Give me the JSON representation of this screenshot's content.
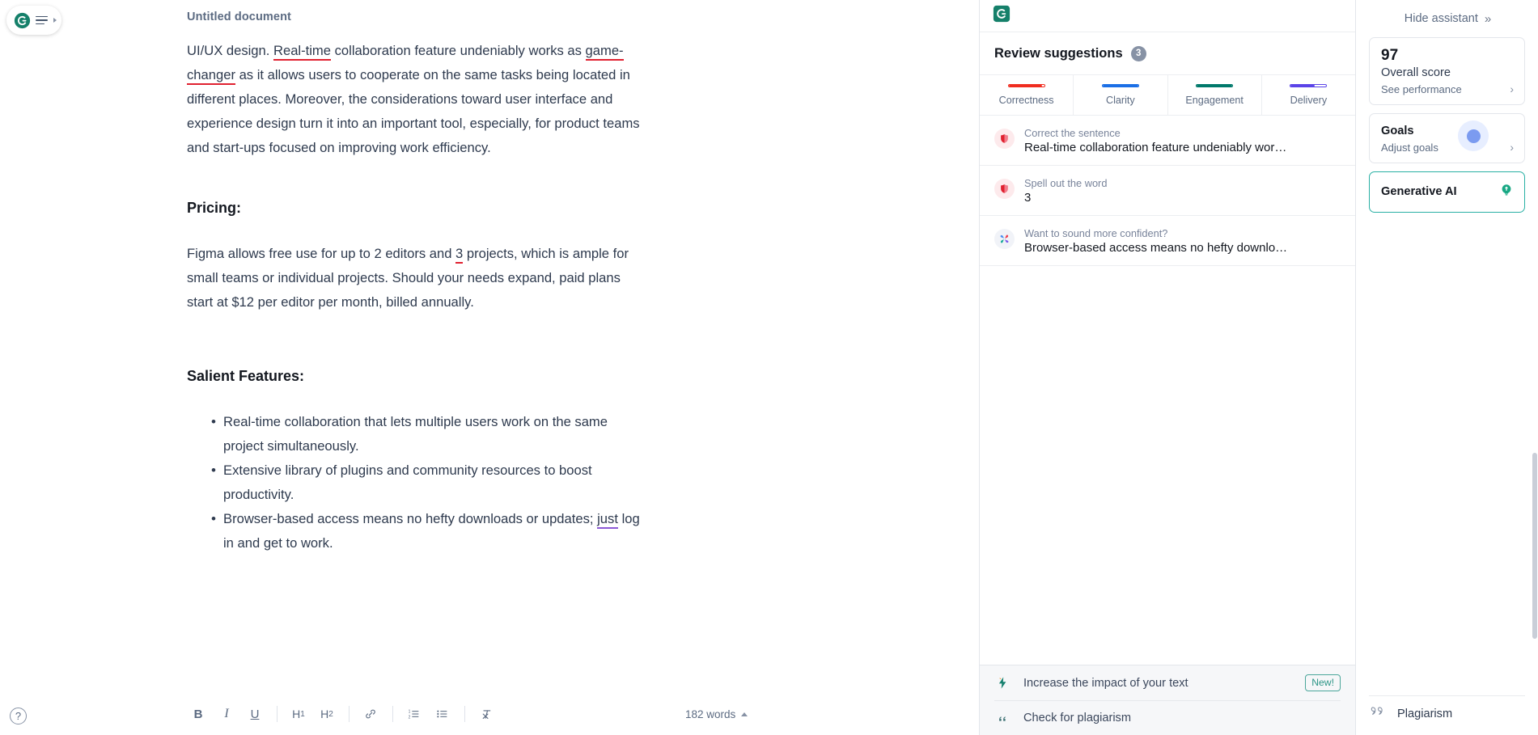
{
  "logo": {
    "brand_icon": "grammarly-g-icon",
    "menu_icon": "hamburger-menu-icon",
    "caret_icon": "caret-right-icon"
  },
  "editor": {
    "doc_title": "Untitled document",
    "paragraph_1": {
      "part_a": "UI/UX design. ",
      "flag_1": "Real-time",
      "part_b": " collaboration feature undeniably works as ",
      "flag_2": "game-changer",
      "part_c": " as it allows users to cooperate on the same tasks being located in different places. Moreover, the considerations toward user interface and experience design turn it into an important tool, especially, for product teams and start-ups focused on improving work efficiency."
    },
    "heading_pricing": "Pricing:",
    "paragraph_2": {
      "part_a": "Figma allows free use for up to 2 editors and ",
      "flag_1": "3",
      "part_b": " projects, which is ample for small teams or individual projects. Should your needs expand, paid plans start at $12 per editor per month, billed annually."
    },
    "heading_features": "Salient Features:",
    "bullets": [
      {
        "text": "Real-time collaboration that lets multiple users work on the same project simultaneously."
      },
      {
        "text": "Extensive library of plugins and community resources to boost productivity."
      },
      {
        "part_a": "Browser-based access means no hefty downloads or updates; ",
        "flag": "just",
        "part_b": " log in and get to work."
      }
    ]
  },
  "toolbar": {
    "bold": "B",
    "italic": "I",
    "underline": "U",
    "h1": "H",
    "h1_sub": "1",
    "h2": "H",
    "h2_sub": "2",
    "link_icon": "link-icon",
    "ordered_list_icon": "ordered-list-icon",
    "bullet_list_icon": "bullet-list-icon",
    "clear_format_icon": "clear-formatting-icon",
    "word_count": "182 words",
    "collapse_icon": "caret-up-icon",
    "help_icon": "help-question-icon",
    "help_glyph": "?"
  },
  "suggestions_panel": {
    "header": "Review suggestions",
    "count": "3",
    "tabs": [
      {
        "label": "Correctness",
        "color": "#f02d20",
        "fill_pct": 93
      },
      {
        "label": "Clarity",
        "color": "#1b6fe6",
        "fill_pct": 100
      },
      {
        "label": "Engagement",
        "color": "#00796b",
        "fill_pct": 100
      },
      {
        "label": "Delivery",
        "color": "#5b44e8",
        "fill_pct": 68
      }
    ],
    "items": [
      {
        "kicker": "Correct the sentence",
        "main": "Real-time collaboration feature undeniably works a…",
        "icon": "shield-icon",
        "icon_style": "red"
      },
      {
        "kicker": "Spell out the word",
        "main": "3",
        "icon": "shield-icon",
        "icon_style": "red"
      },
      {
        "kicker": "Want to sound more confident?",
        "main": "Browser-based access means no hefty downloads…",
        "icon": "flower-icon",
        "icon_style": "flower"
      }
    ],
    "footer": [
      {
        "label": "Increase the impact of your text",
        "badge": "New!",
        "icon": "lightning-bolt-icon"
      },
      {
        "label": "Check for plagiarism",
        "badge": "",
        "icon": "quote-marks-icon"
      }
    ]
  },
  "assistant": {
    "hide_label": "Hide assistant",
    "hide_icon": "chevron-double-right-icon",
    "score_card": {
      "score": "97",
      "title": "Overall score",
      "sub": "See performance",
      "chevron": "›"
    },
    "goals_card": {
      "title": "Goals",
      "sub": "Adjust goals",
      "chevron": "›",
      "indicator_icon": "goal-dot-indicator"
    },
    "genai_card": {
      "title": "Generative AI",
      "icon": "lightbulb-icon",
      "border_color": "#29b0a4"
    },
    "plagiarism": {
      "label": "Plagiarism",
      "icon": "quote-marks-icon"
    }
  }
}
